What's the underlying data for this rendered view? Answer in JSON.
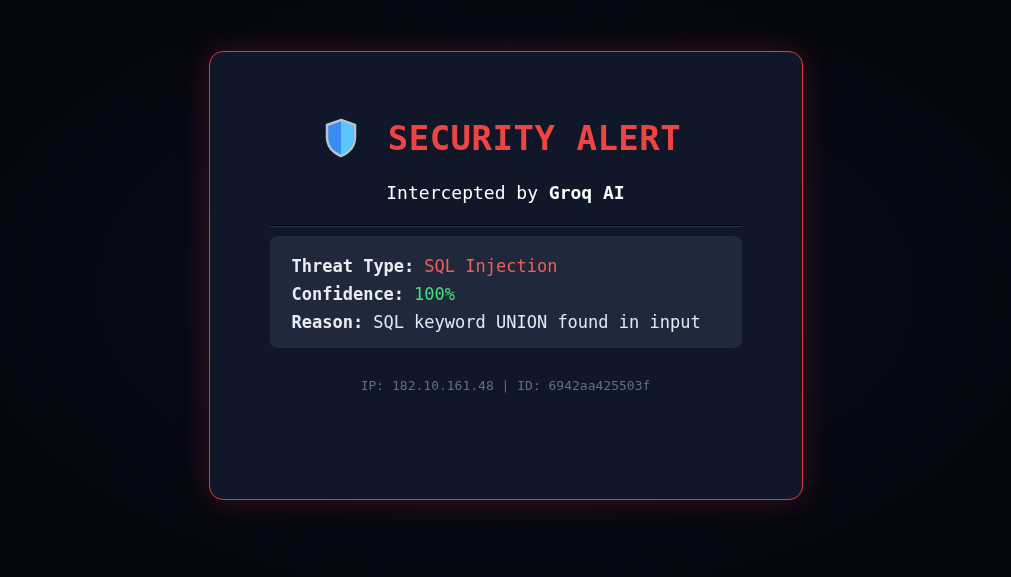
{
  "alert": {
    "title": "SECURITY ALERT",
    "subtitle": "Intercepted by **Groq AI**",
    "details": [
      {
        "label": "Threat Type:",
        "value": "SQL Injection",
        "color": "#f25f5c"
      },
      {
        "label": "Confidence:",
        "value": "100%",
        "color": "#4ade80"
      },
      {
        "label": "Reason:",
        "value": "SQL keyword UNION found in input",
        "color": "#e2e8f0"
      }
    ],
    "footer": "IP: 182.10.161.48 | ID: 6942aa425503f"
  }
}
